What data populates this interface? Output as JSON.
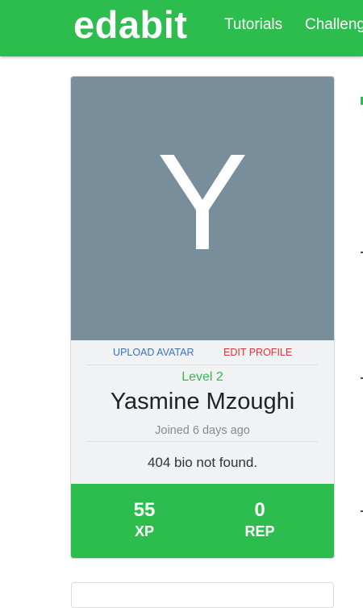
{
  "navbar": {
    "brand": "edabit",
    "links": [
      "Tutorials",
      "Challenges"
    ]
  },
  "profile": {
    "avatar_letter": "Y",
    "upload_avatar_label": "UPLOAD AVATAR",
    "edit_profile_label": "EDIT PROFILE",
    "level": "Level 2",
    "name": "Yasmine Mzoughi",
    "joined": "Joined 6 days ago",
    "bio": "404 bio not found.",
    "stats": {
      "xp_value": "55",
      "xp_label": "XP",
      "rep_value": "0",
      "rep_label": "REP"
    }
  },
  "colors": {
    "brand_green": "#2dbd4e",
    "avatar_bg": "#788e9a",
    "upload_link": "#3b73b9",
    "edit_link": "#d9343b"
  }
}
